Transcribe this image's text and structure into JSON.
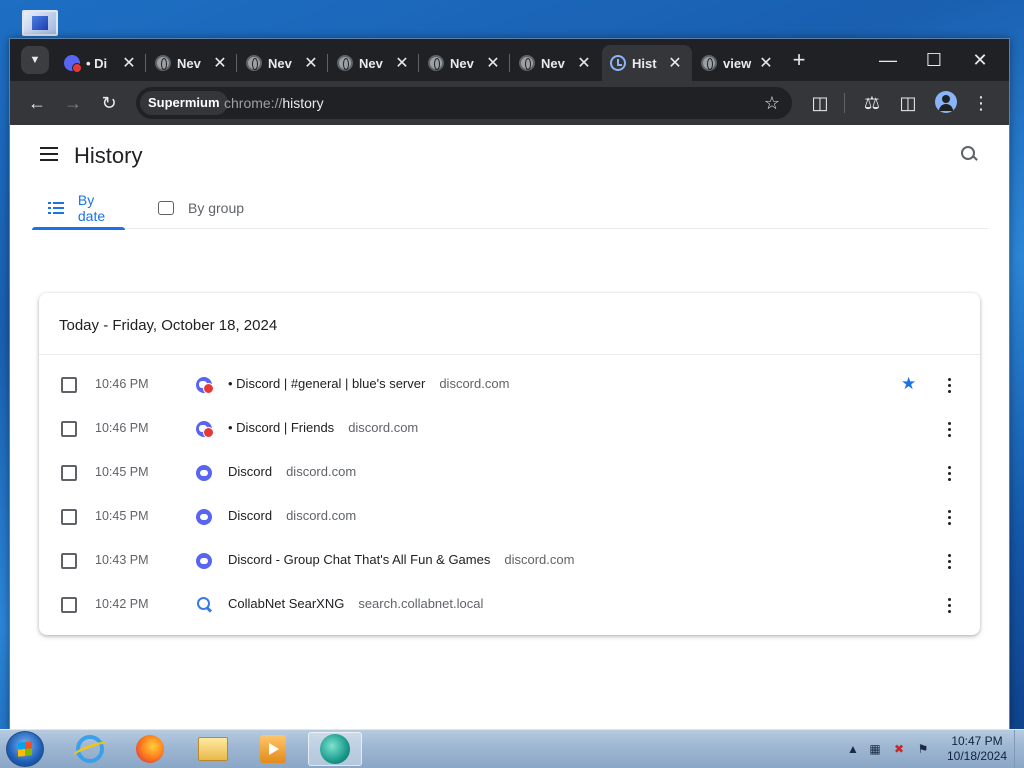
{
  "browser": {
    "tabs": [
      {
        "title": "• Di",
        "icon": "discord-icon",
        "active": false
      },
      {
        "title": "Nev",
        "icon": "globe-icon",
        "active": false
      },
      {
        "title": "Nev",
        "icon": "globe-icon",
        "active": false
      },
      {
        "title": "Nev",
        "icon": "globe-icon",
        "active": false
      },
      {
        "title": "Nev",
        "icon": "globe-icon",
        "active": false
      },
      {
        "title": "Nev",
        "icon": "globe-icon",
        "active": false
      },
      {
        "title": "Hist",
        "icon": "history-icon",
        "active": true
      },
      {
        "title": "view",
        "icon": "globe-icon",
        "active": false
      }
    ],
    "profile_chip": "Supermium",
    "url_scheme": "chrome://",
    "url_path": "history"
  },
  "page": {
    "title": "History",
    "tabs": [
      {
        "label": "By date",
        "active": true
      },
      {
        "label": "By group",
        "active": false
      }
    ],
    "section_header": "Today - Friday, October 18, 2024",
    "entries": [
      {
        "time": "10:46 PM",
        "title": "• Discord | #general | blue's server",
        "domain": "discord.com",
        "icon": "discord-notification-icon",
        "starred": true
      },
      {
        "time": "10:46 PM",
        "title": "• Discord | Friends",
        "domain": "discord.com",
        "icon": "discord-notification-icon",
        "starred": false
      },
      {
        "time": "10:45 PM",
        "title": "Discord",
        "domain": "discord.com",
        "icon": "discord-icon",
        "starred": false
      },
      {
        "time": "10:45 PM",
        "title": "Discord",
        "domain": "discord.com",
        "icon": "discord-icon",
        "starred": false
      },
      {
        "time": "10:43 PM",
        "title": "Discord - Group Chat That's All Fun & Games",
        "domain": "discord.com",
        "icon": "discord-icon",
        "starred": false
      },
      {
        "time": "10:42 PM",
        "title": "CollabNet SearXNG",
        "domain": "search.collabnet.local",
        "icon": "search-icon",
        "starred": false
      }
    ]
  },
  "taskbar": {
    "clock_time": "10:47 PM",
    "clock_date": "10/18/2024"
  },
  "colors": {
    "accent": "#1a73e8",
    "tabstrip": "#202124",
    "toolbar": "#35363a"
  }
}
